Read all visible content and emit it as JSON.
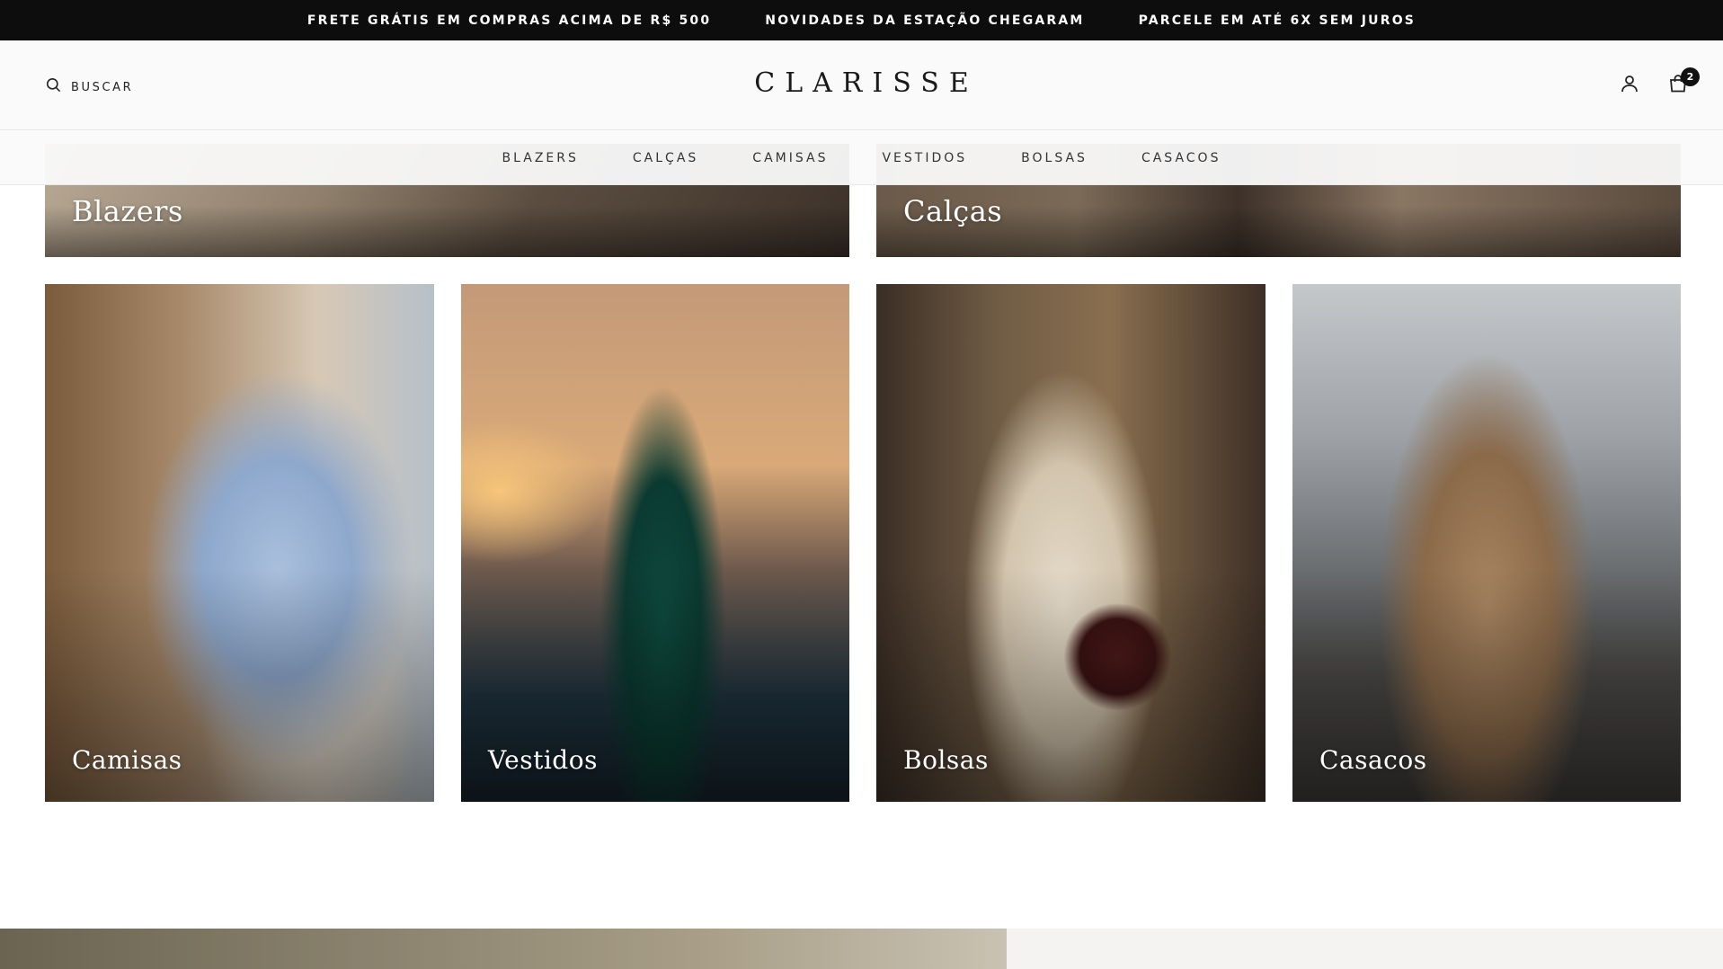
{
  "announcement": {
    "items": [
      "FRETE GRÁTIS EM COMPRAS ACIMA DE R$ 500",
      "NOVIDADES DA ESTAÇÃO CHEGARAM",
      "PARCELE EM ATÉ 6X SEM JUROS"
    ]
  },
  "header": {
    "search_label": "BUSCAR",
    "logo": "CLARISSE",
    "cart_count": "2",
    "icons": {
      "search": "search-icon",
      "account": "user-icon",
      "cart": "bag-icon"
    }
  },
  "nav": {
    "items": [
      "BLAZERS",
      "CALÇAS",
      "CAMISAS",
      "VESTIDOS",
      "BOLSAS",
      "CASACOS"
    ]
  },
  "collections": {
    "top": [
      "Blazers",
      "Calças"
    ],
    "grid": [
      "Camisas",
      "Vestidos",
      "Bolsas",
      "Casacos"
    ]
  }
}
